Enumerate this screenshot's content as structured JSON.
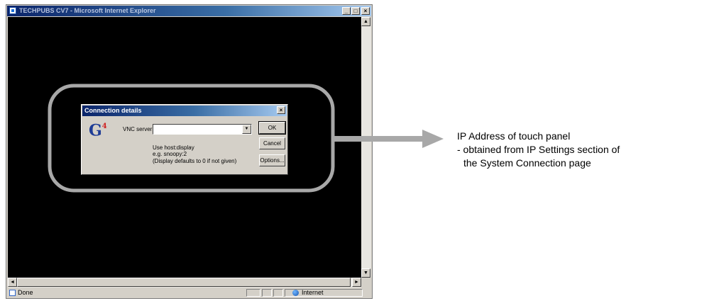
{
  "window": {
    "title": "TECHPUBS CV7 - Microsoft Internet Explorer",
    "minimize": "_",
    "maximize": "□",
    "close": "×"
  },
  "dialog": {
    "title": "Connection details",
    "close": "×",
    "logo_text": "G",
    "logo_superscript": "4",
    "server_label": "VNC server:",
    "server_value": "",
    "dropdown_glyph": "▼",
    "hint_line1": "Use host:display",
    "hint_line2": "e.g. snoopy:2",
    "hint_line3": "(Display defaults to 0 if not given)",
    "buttons": {
      "ok": "OK",
      "cancel": "Cancel",
      "options": "Options..."
    }
  },
  "status": {
    "left": "Done",
    "zone": "Internet"
  },
  "scroll": {
    "up": "▲",
    "down": "▼",
    "left": "◄",
    "right": "►"
  },
  "annotation": {
    "line1": "IP Address of touch panel",
    "line2": "- obtained from IP Settings section of",
    "line3": "the System Connection page"
  },
  "colors": {
    "highlight_outline": "#a8a8a8",
    "arrow": "#a8a8a8",
    "titlebar": "#0a246a",
    "viewport": "#000000"
  }
}
